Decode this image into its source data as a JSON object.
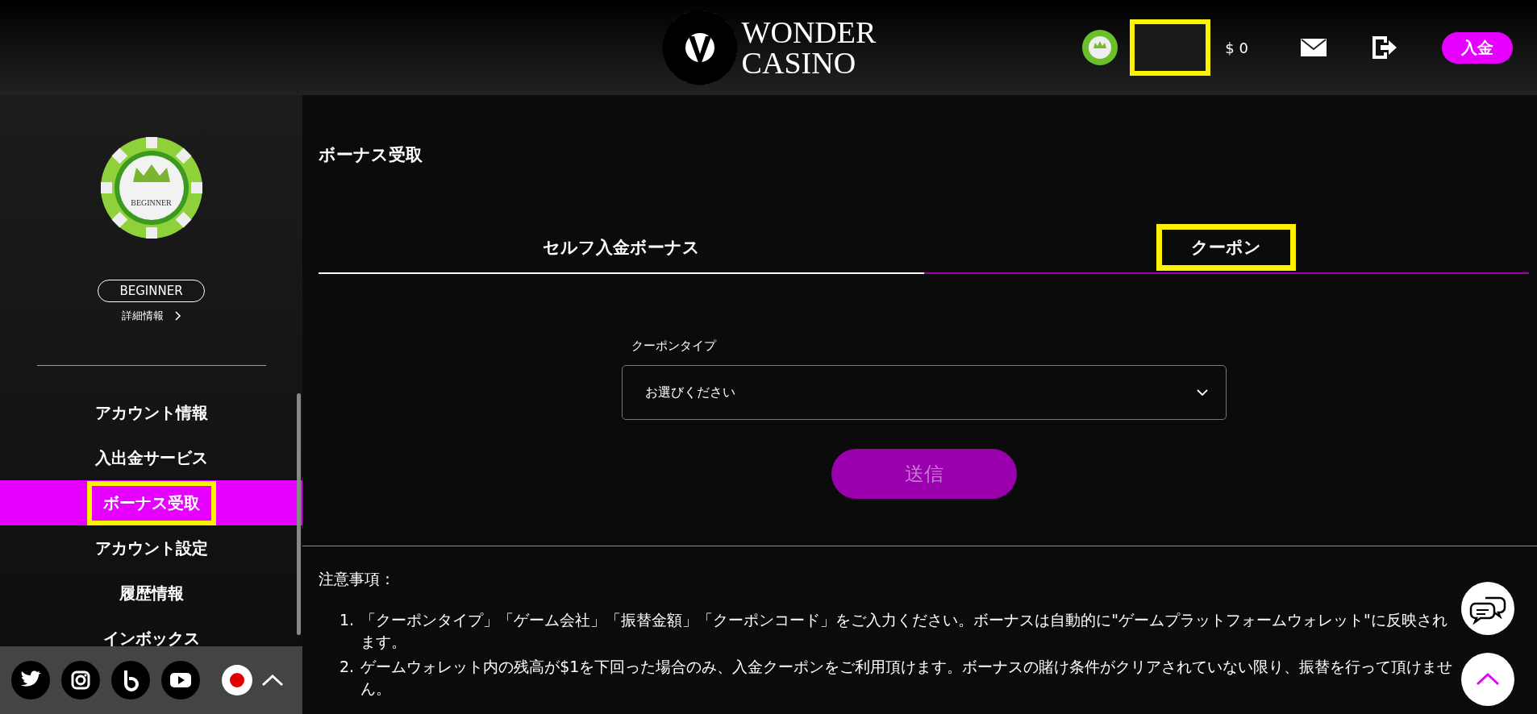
{
  "header": {
    "logo_line1": "WONDER",
    "logo_line2": "CASINO",
    "username_highlighted": true,
    "balance": "$ 0",
    "deposit_button": "入金"
  },
  "sidebar": {
    "rank_badge": "BEGINNER",
    "chip_label": "BEGINNER",
    "details_link": "詳細情報",
    "items": [
      {
        "label": "アカウント情報",
        "selected": false,
        "highlighted": false
      },
      {
        "label": "入出金サービス",
        "selected": false,
        "highlighted": false
      },
      {
        "label": "ボーナス受取",
        "selected": true,
        "highlighted": true
      },
      {
        "label": "アカウント設定",
        "selected": false,
        "highlighted": false
      },
      {
        "label": "履歴情報",
        "selected": false,
        "highlighted": false
      },
      {
        "label": "インボックス",
        "selected": false,
        "highlighted": false
      }
    ]
  },
  "page_title": "ボーナス受取",
  "tabs": [
    {
      "label": "セルフ入金ボーナス",
      "selected": false,
      "highlighted": false
    },
    {
      "label": "クーポン",
      "selected": true,
      "highlighted": true
    }
  ],
  "form": {
    "label": "クーポンタイプ",
    "select_value": "お選びください",
    "submit": "送信",
    "submit_disabled": true
  },
  "notes": {
    "title": "注意事項：",
    "items": [
      {
        "number": "1.",
        "text": "「クーポンタイプ」「ゲーム会社」「振替金額」「クーポンコード」をご入力ください。ボーナスは自動的に\"ゲームプラットフォームウォレット\"に反映されます。"
      },
      {
        "number": "2.",
        "text": "ゲームウォレット内の残高が$1を下回った場合のみ、入金クーポンをご利用頂けます。ボーナスの賭け条件がクリアされていない限り、振替を行って頂けません。"
      }
    ]
  }
}
